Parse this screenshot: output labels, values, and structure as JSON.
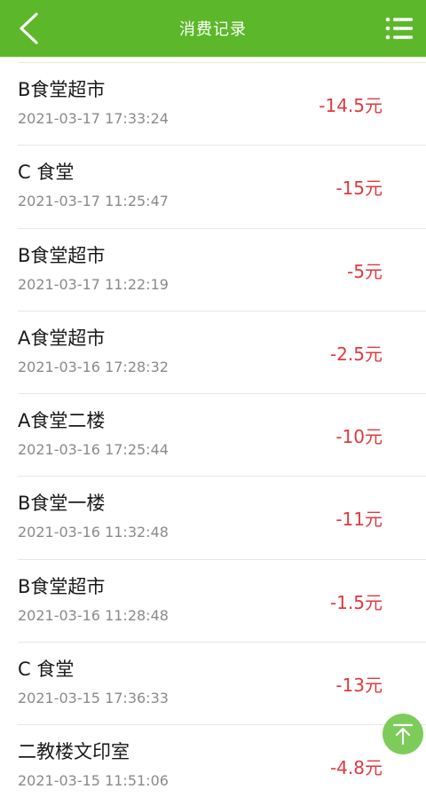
{
  "header": {
    "title": "消费记录",
    "back_icon": "chevron-left-icon",
    "menu_icon": "list-menu-icon",
    "bar_color": "#5cb82a"
  },
  "records": [
    {
      "name": "B食堂超市",
      "time": "2021-03-17 17:33:24",
      "amount": "-14.5元"
    },
    {
      "name": "C 食堂",
      "time": "2021-03-17 11:25:47",
      "amount": "-15元"
    },
    {
      "name": "B食堂超市",
      "time": "2021-03-17 11:22:19",
      "amount": "-5元"
    },
    {
      "name": "A食堂超市",
      "time": "2021-03-16 17:28:32",
      "amount": "-2.5元"
    },
    {
      "name": "A食堂二楼",
      "time": "2021-03-16 17:25:44",
      "amount": "-10元"
    },
    {
      "name": "B食堂一楼",
      "time": "2021-03-16 11:32:48",
      "amount": "-11元"
    },
    {
      "name": "B食堂超市",
      "time": "2021-03-16 11:28:48",
      "amount": "-1.5元"
    },
    {
      "name": "C 食堂",
      "time": "2021-03-15 17:36:33",
      "amount": "-13元"
    },
    {
      "name": "二教楼文印室",
      "time": "2021-03-15 11:51:06",
      "amount": "-4.8元"
    }
  ],
  "scroll_top": {
    "icon": "arrow-up-to-top-icon",
    "color": "#7dcc5a"
  },
  "colors": {
    "amount": "#e0393e",
    "time": "#8a8a8a",
    "name": "#1a1a1a"
  }
}
